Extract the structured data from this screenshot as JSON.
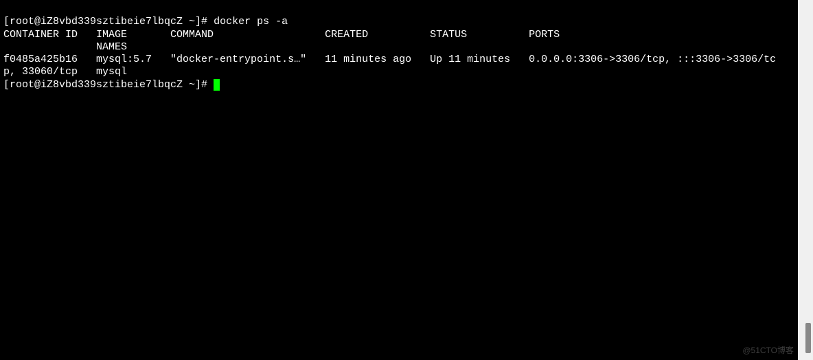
{
  "prompt1": "[root@iZ8vbd339sztibeie7lbqcZ ~]# ",
  "command1": "docker ps -a",
  "header_line1": "CONTAINER ID   IMAGE       COMMAND                  CREATED          STATUS          PORTS",
  "header_line2": "               NAMES",
  "data_line1": "f0485a425b16   mysql:5.7   \"docker-entrypoint.s…\"   11 minutes ago   Up 11 minutes   0.0.0.0:3306->3306/tcp, :::3306->3306/tc",
  "data_line2": "p, 33060/tcp   mysql",
  "prompt2": "[root@iZ8vbd339sztibeie7lbqcZ ~]# ",
  "watermark": "@51CTO博客"
}
